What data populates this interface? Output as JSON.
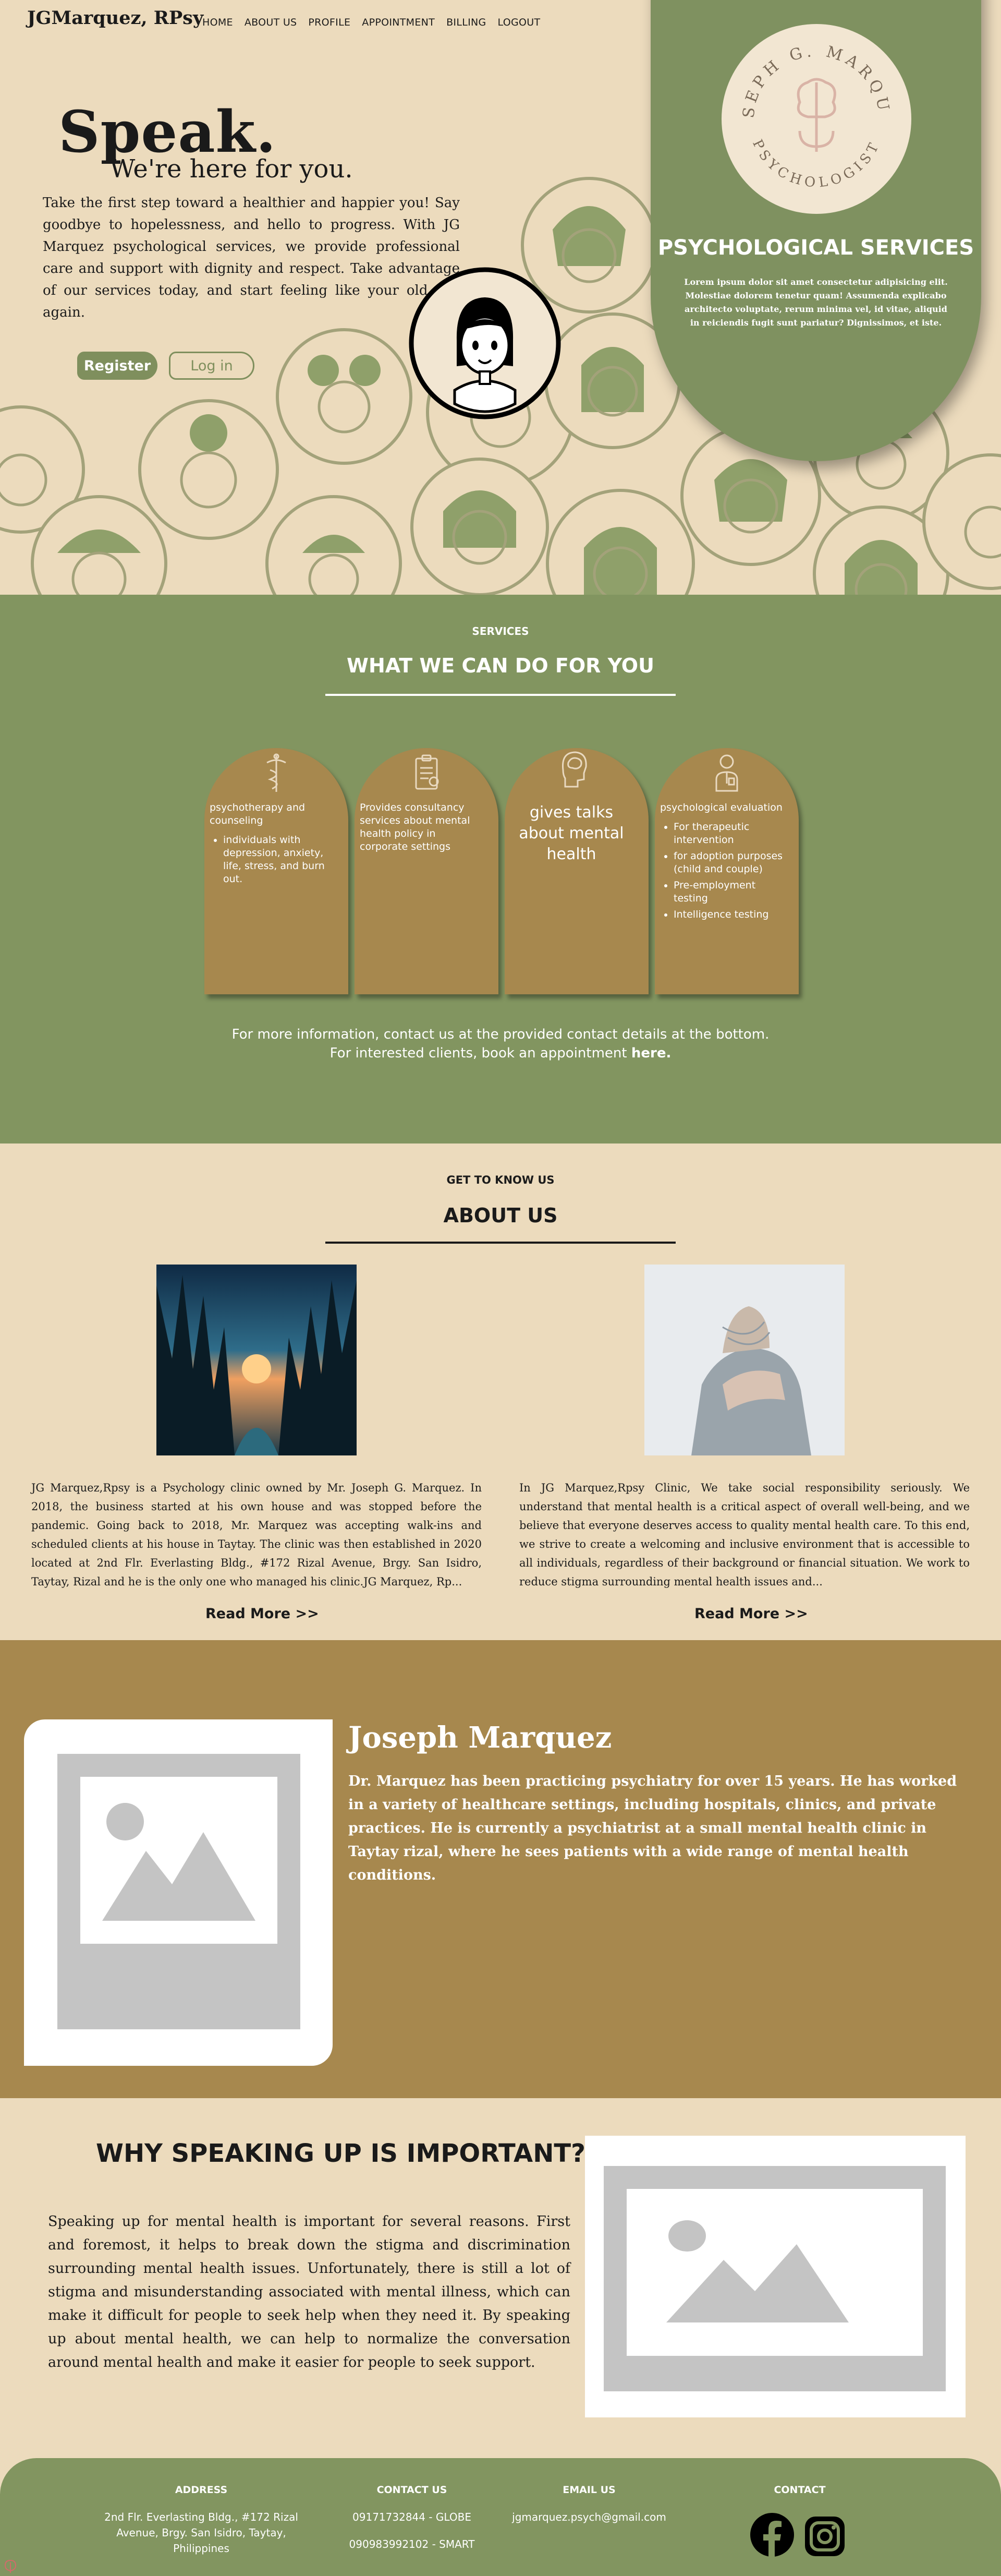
{
  "header": {
    "brand": "JGMarquez, RPsy",
    "nav": [
      "HOME",
      "ABOUT US",
      "PROFILE",
      "APPOINTMENT",
      "BILLING",
      "LOGOUT"
    ]
  },
  "hero": {
    "title": "Speak.",
    "subtitle": "We're here for you.",
    "text": "Take the first step toward a healthier and happier you! Say goodbye to hopelessness, and hello to progress. With JG Marquez psychological services, we provide professional care and support with dignity and respect. Take advantage of our services today, and start feeling like your old self again.",
    "register_label": "Register",
    "login_label": "Log in"
  },
  "panel": {
    "seal_name": "JOSEPH G. MARQUEZ",
    "seal_role": "PSYCHOLOGIST",
    "title": "PSYCHOLOGICAL SERVICES",
    "text": "Lorem ipsum dolor sit amet consectetur adipisicing elit. Molestiae dolorem tenetur quam! Assumenda explicabo architecto voluptate, rerum minima vel, id vitae, aliquid in reiciendis fugit sunt pariatur? Dignissimos, et iste."
  },
  "services": {
    "kicker": "SERVICES",
    "title": "WHAT WE CAN DO FOR YOU",
    "cards": [
      {
        "icon": "caduceus-icon",
        "heading": "psychotherapy and counseling",
        "items": [
          "individuals with depression, anxiety, life, stress, and burn out."
        ]
      },
      {
        "icon": "clipboard-icon",
        "heading": "Provides consultancy services about mental health policy in corporate settings",
        "items": []
      },
      {
        "icon": "brain-head-icon",
        "heading": "gives talks about mental health",
        "items": []
      },
      {
        "icon": "psychologist-icon",
        "heading": "psychological evaluation",
        "items": [
          "For therapeutic intervention",
          "for adoption purposes (child and couple)",
          "Pre-employment testing",
          "Intelligence testing"
        ]
      }
    ],
    "note_line1": "For more information, contact us at the provided contact details at the bottom.",
    "note_line2_prefix": "For interested clients, book an appointment ",
    "note_line2_link": "here."
  },
  "about": {
    "kicker": "GET TO KNOW US",
    "title": "ABOUT US",
    "left_text": "JG Marquez,Rpsy is a Psychology clinic owned by Mr. Joseph G. Marquez. In 2018, the business started at his own house and was stopped before the pandemic. Going back to 2018, Mr. Marquez was accepting walk-ins and scheduled clients at his house in Taytay. The clinic was then established in 2020 located at 2nd Flr. Everlasting Bldg., #172 Rizal Avenue, Brgy. San Isidro, Taytay, Rizal and he is the only one who managed his clinic.JG Marquez, Rp...",
    "right_text": "In JG Marquez,Rpsy Clinic, We take social responsibility seriously. We understand that mental health is a critical aspect of overall well-being, and we believe that everyone deserves access to quality mental health care. To this end, we strive to create a welcoming and inclusive environment that is accessible to all individuals, regardless of their background or financial situation. We work to reduce stigma surrounding mental health issues and...",
    "read_more": "Read More >>"
  },
  "doctor": {
    "name": "Joseph Marquez",
    "bio": "Dr. Marquez has been practicing psychiatry for over 15 years. He has worked in a variety of healthcare settings, including hospitals, clinics, and private practices. He is currently a psychiatrist at a small mental health clinic in Taytay rizal, where he sees patients with a wide range of mental health conditions."
  },
  "why": {
    "title": "WHY SPEAKING UP IS IMPORTANT?",
    "text": "Speaking up for mental health is important for several reasons. First and foremost, it helps to break down the stigma and discrimination surrounding mental health issues. Unfortunately, there is still a lot of stigma and misunderstanding associated with mental illness, which can make it difficult for people to seek help when they need it. By speaking up about mental health, we can help to normalize the conversation around mental health and make it easier for people to seek support."
  },
  "footer": {
    "address_label": "ADDRESS",
    "address_line1": "2nd Flr. Everlasting Bldg., #172 Rizal",
    "address_line2": "Avenue, Brgy. San Isidro, Taytay,",
    "address_line3": "Philippines",
    "contact_label": "CONTACT US",
    "phone1": "09171732844 - GLOBE",
    "phone2": "090983992102 - SMART",
    "email_label": "EMAIL US",
    "email": "jgmarquez.psych@gmail.com",
    "social_label": "CONTACT",
    "socials": [
      "facebook-icon",
      "instagram-icon"
    ]
  },
  "colors": {
    "cream": "#ecdbbd",
    "olive": "#829560",
    "brown": "#a7884e"
  }
}
